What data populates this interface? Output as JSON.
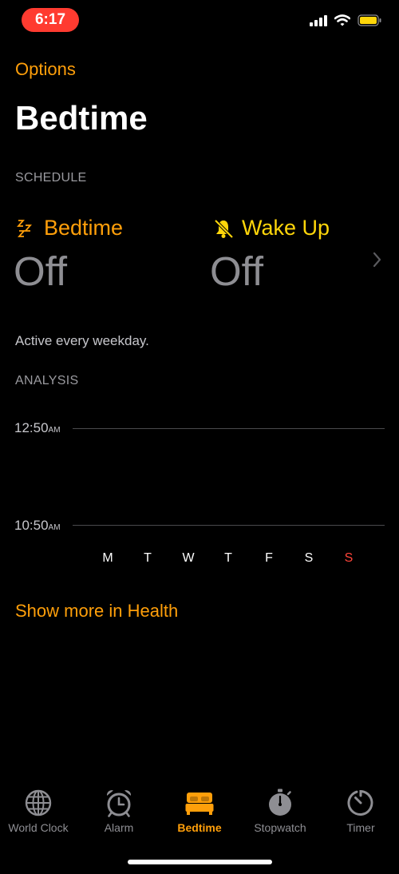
{
  "status_bar": {
    "time": "6:17",
    "battery_color": "#ffd60a"
  },
  "header": {
    "back_label": "Options",
    "title": "Bedtime"
  },
  "schedule": {
    "section_label": "SCHEDULE",
    "bedtime_label": "Bedtime",
    "bedtime_value": "Off",
    "bedtime_icon": "zzz-icon",
    "wakeup_label": "Wake Up",
    "wakeup_value": "Off",
    "wakeup_icon": "bell-slash-icon",
    "active_text": "Active every weekday."
  },
  "analysis": {
    "section_label": "ANALYSIS",
    "ticks": [
      {
        "time": "12:50",
        "suffix": "AM"
      },
      {
        "time": "10:50",
        "suffix": "AM"
      }
    ],
    "days": [
      "M",
      "T",
      "W",
      "T",
      "F",
      "S",
      "S"
    ],
    "weekend_color": "#ff453a"
  },
  "health_link": "Show more in Health",
  "tab_bar": {
    "active_color": "#ff9f0a",
    "tabs": [
      {
        "label": "World Clock",
        "icon": "globe-icon",
        "active": false
      },
      {
        "label": "Alarm",
        "icon": "alarm-clock-icon",
        "active": false
      },
      {
        "label": "Bedtime",
        "icon": "bed-icon",
        "active": true
      },
      {
        "label": "Stopwatch",
        "icon": "stopwatch-icon",
        "active": false
      },
      {
        "label": "Timer",
        "icon": "timer-icon",
        "active": false
      }
    ]
  }
}
